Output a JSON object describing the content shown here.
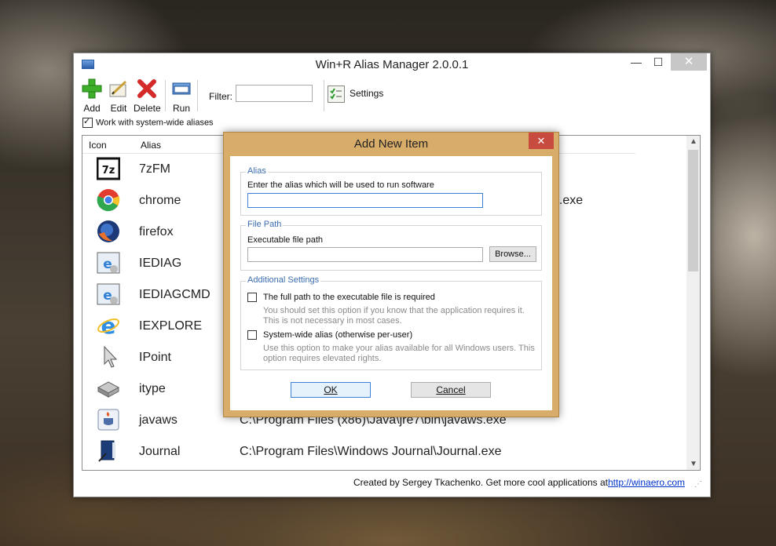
{
  "window": {
    "title": "Win+R Alias Manager 2.0.0.1",
    "min": "—",
    "max": "☐",
    "close": "✕"
  },
  "toolbar": {
    "add": "Add",
    "edit": "Edit",
    "delete": "Delete",
    "run": "Run",
    "filter_label": "Filter:",
    "filter_value": "",
    "settings": "Settings"
  },
  "system_wide": {
    "label": "Work with system-wide aliases",
    "checked": true
  },
  "list": {
    "columns": {
      "icon": "Icon",
      "alias": "Alias"
    },
    "rows": [
      {
        "icon": "7zip-icon",
        "alias": "7zFM",
        "path": ""
      },
      {
        "icon": "chrome-icon",
        "alias": "chrome",
        "path": "e.exe"
      },
      {
        "icon": "firefox-icon",
        "alias": "firefox",
        "path": ""
      },
      {
        "icon": "iediag-icon",
        "alias": "IEDIAG",
        "path": ""
      },
      {
        "icon": "iediagcmd-icon",
        "alias": "IEDIAGCMD",
        "path": ""
      },
      {
        "icon": "ie-icon",
        "alias": "IEXPLORE",
        "path": ""
      },
      {
        "icon": "pointer-icon",
        "alias": "IPoint",
        "path": ""
      },
      {
        "icon": "keyboard-key-icon",
        "alias": "itype",
        "path": ""
      },
      {
        "icon": "java-icon",
        "alias": "javaws",
        "path": "C:\\Program Files (x86)\\Java\\jre7\\bin\\javaws.exe"
      },
      {
        "icon": "journal-icon",
        "alias": "Journal",
        "path": "C:\\Program Files\\Windows Journal\\Journal.exe"
      }
    ]
  },
  "status": {
    "text": "Created by Sergey Tkachenko. Get more cool applications at",
    "link": "http://winaero.com"
  },
  "dialog": {
    "title": "Add New Item",
    "close": "✕",
    "alias_group": "Alias",
    "alias_label": "Enter the alias which will be used to run software",
    "alias_value": "",
    "path_group": "File Path",
    "path_label": "Executable file path",
    "path_value": "",
    "browse": "Browse...",
    "settings_group": "Additional Settings",
    "opt1_label": "The full path to the executable file is required",
    "opt1_hint": "You should set this option if you know that the application requires it. This is not necessary in most cases.",
    "opt1_checked": false,
    "opt2_label": "System-wide alias (otherwise per-user)",
    "opt2_hint": "Use this option to make your alias available for all Windows users. This option requires elevated rights.",
    "opt2_checked": false,
    "ok": "OK",
    "cancel": "Cancel"
  },
  "colors": {
    "dialog_frame": "#d8ad6a",
    "close_red": "#c74b3e",
    "group_title": "#3c6db0",
    "link": "#0033cc"
  }
}
